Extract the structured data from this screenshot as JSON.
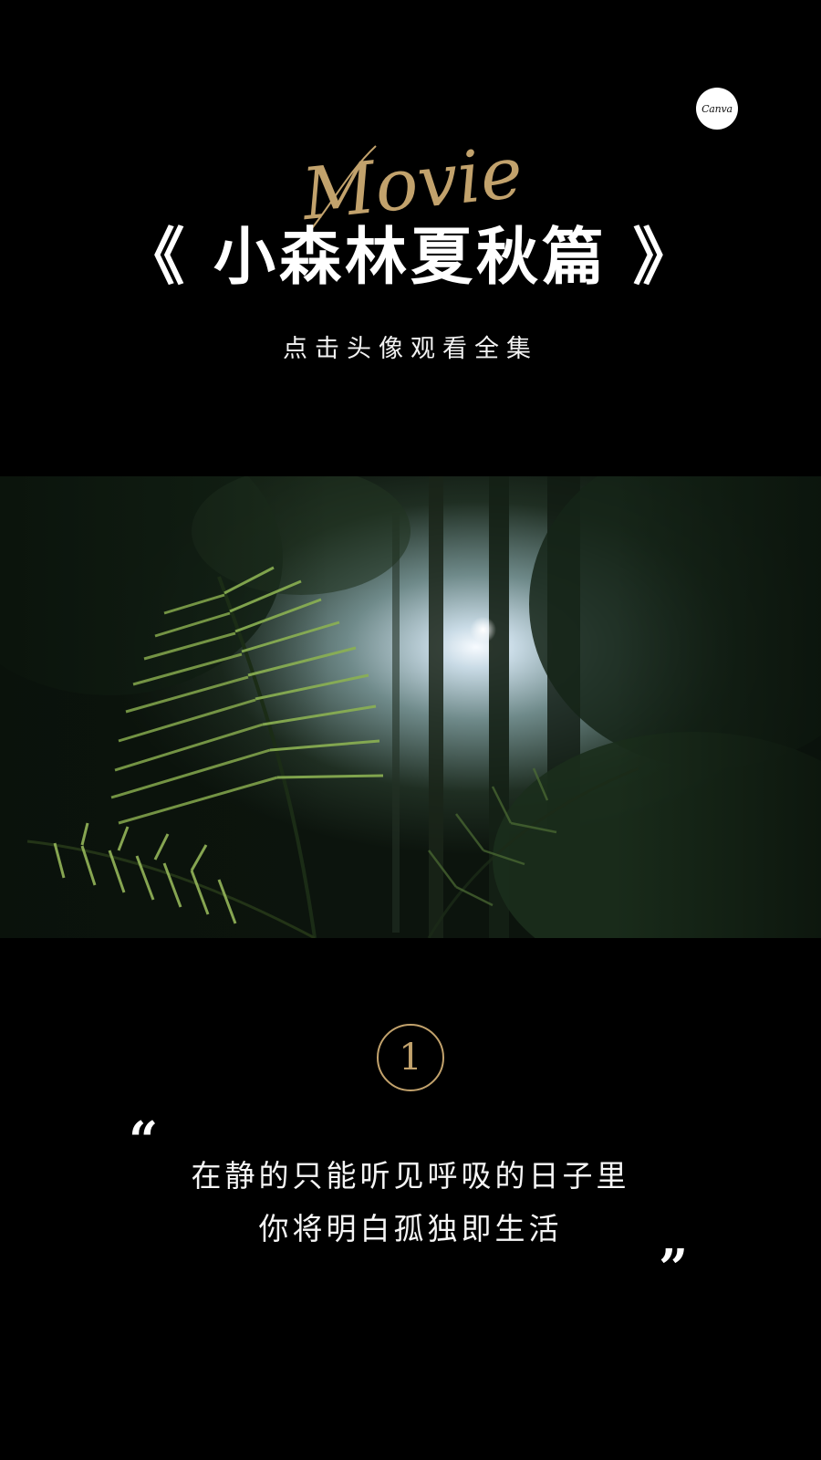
{
  "brand": {
    "logo_text": "Canva"
  },
  "header": {
    "script_word": "Movie",
    "title": "《 小森林夏秋篇 》",
    "subtitle": "点击头像观看全集"
  },
  "hero": {
    "description_icon": "forest-fern-photo"
  },
  "quote": {
    "number": "1",
    "open_mark": "“",
    "close_mark": "”",
    "lines": [
      "在静的只能听见呼吸的日子里",
      "你将明白孤独即生活"
    ]
  },
  "colors": {
    "background": "#000000",
    "accent_gold": "#c2a26c",
    "text": "#ffffff"
  }
}
